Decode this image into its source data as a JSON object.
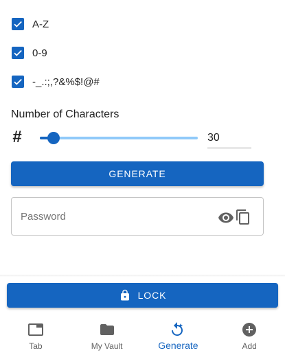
{
  "options": [
    {
      "label": "A-Z",
      "checked": true
    },
    {
      "label": "0-9",
      "checked": true
    },
    {
      "label": "-_.:;,?&%$!@#",
      "checked": true
    }
  ],
  "length_section": {
    "label": "Number of Characters",
    "hash_symbol": "#",
    "value": "30",
    "slider_fraction": 0.05
  },
  "generate_button": {
    "label": "GENERATE"
  },
  "password_field": {
    "placeholder": "Password",
    "eye_icon": "eye-icon",
    "copy_icon": "copy-icon"
  },
  "lock_button": {
    "label": "LOCK",
    "icon": "lock-icon"
  },
  "nav": [
    {
      "label": "Tab",
      "icon": "tab-icon",
      "active": false
    },
    {
      "label": "My Vault",
      "icon": "folder-icon",
      "active": false
    },
    {
      "label": "Generate",
      "icon": "generate-icon",
      "active": true
    },
    {
      "label": "Add",
      "icon": "add-circle-icon",
      "active": false
    }
  ],
  "colors": {
    "accent": "#1565c0",
    "accent_light": "#90caf9",
    "icon_gray": "#616161"
  }
}
